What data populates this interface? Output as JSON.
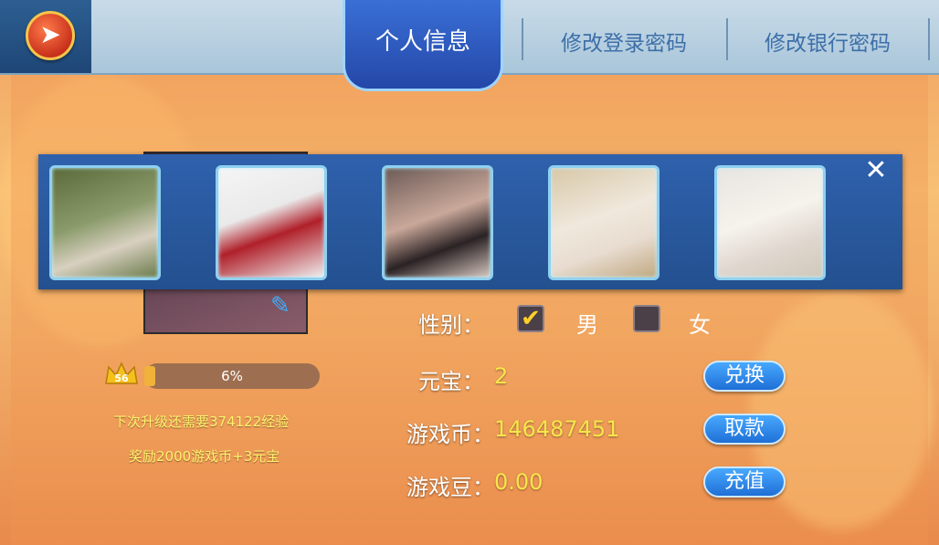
{
  "header": {
    "back_icon": "back-arrow-icon",
    "tabs": [
      {
        "label": "个人信息",
        "active": true
      },
      {
        "label": "修改登录密码",
        "active": false
      },
      {
        "label": "修改银行密码",
        "active": false
      }
    ]
  },
  "avatar_picker": {
    "options_count": 5,
    "close_icon": "close-icon"
  },
  "profile": {
    "level": "56",
    "progress_text": "6%",
    "progress_value": 0.06,
    "next_level_text": "下次升级还需要374122经验",
    "reward_text": "奖励2000游戏币+3元宝",
    "fields": {
      "gender_label": "性别：",
      "gender_male": "男",
      "gender_female": "女",
      "gender_selected": "男",
      "yuanbao_label": "元宝：",
      "yuanbao_value": "2",
      "coins_label": "游戏币：",
      "coins_value": "146487451",
      "beans_label": "游戏豆：",
      "beans_value": "0.00"
    },
    "buttons": {
      "exchange": "兑换",
      "withdraw": "取款",
      "recharge": "充值"
    }
  },
  "colors": {
    "accent_blue": "#2447a8",
    "value_yellow": "#f7e64a",
    "button_blue": "#1f6fd6"
  }
}
